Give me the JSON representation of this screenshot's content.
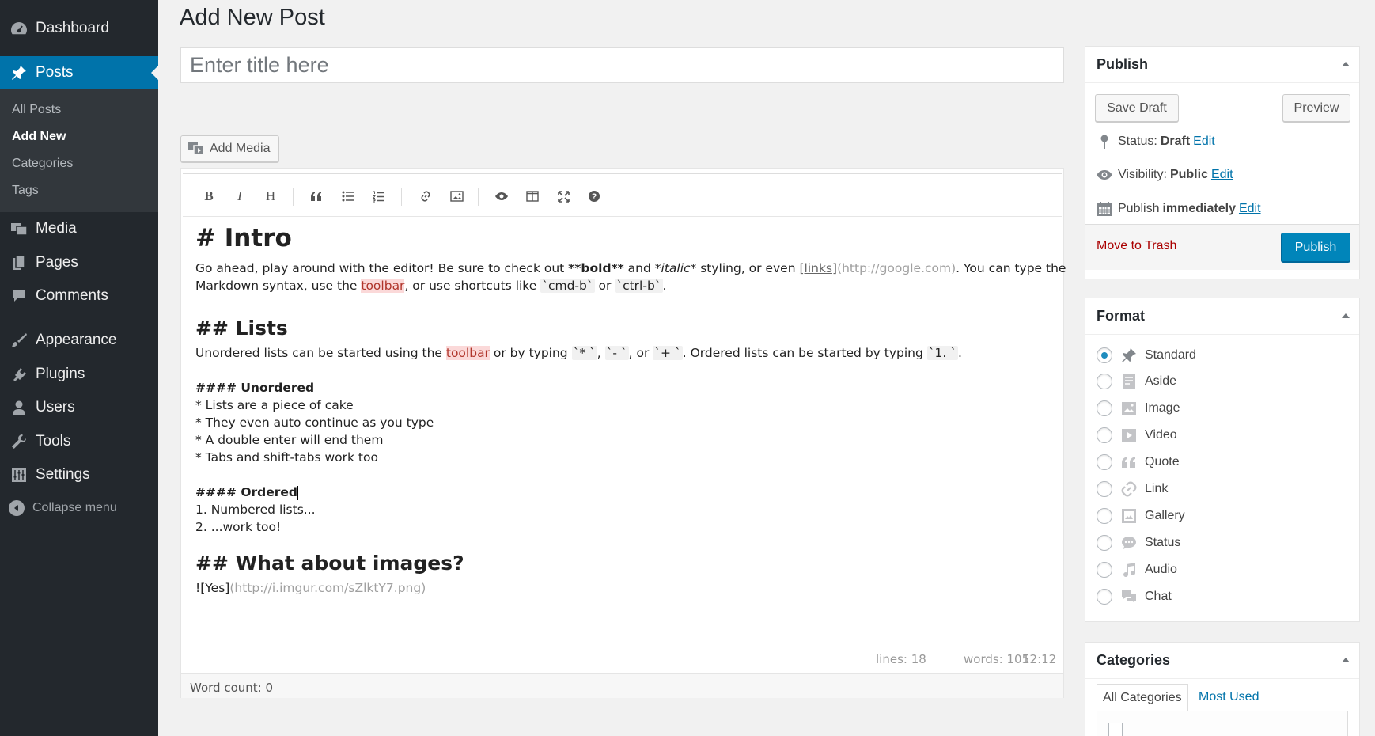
{
  "sidebar": {
    "items": [
      {
        "label": "Dashboard",
        "icon": "dashboard-icon"
      },
      {
        "label": "Posts",
        "icon": "pin-icon"
      },
      {
        "label": "Media",
        "icon": "media-icon"
      },
      {
        "label": "Pages",
        "icon": "pages-icon"
      },
      {
        "label": "Comments",
        "icon": "comment-icon"
      },
      {
        "label": "Appearance",
        "icon": "brush-icon"
      },
      {
        "label": "Plugins",
        "icon": "plug-icon"
      },
      {
        "label": "Users",
        "icon": "user-icon"
      },
      {
        "label": "Tools",
        "icon": "wrench-icon"
      },
      {
        "label": "Settings",
        "icon": "settings-icon"
      }
    ],
    "submenu": [
      "All Posts",
      "Add New",
      "Categories",
      "Tags"
    ],
    "collapse_label": "Collapse menu"
  },
  "main": {
    "page_title": "Add New Post",
    "title_placeholder": "Enter title here",
    "add_media_label": "Add Media"
  },
  "editor": {
    "toolbar": [
      "bold-icon",
      "italic-icon",
      "heading-icon",
      "quote-icon",
      "unordered-list-icon",
      "ordered-list-icon",
      "link-icon",
      "image-icon",
      "preview-icon",
      "side-by-side-icon",
      "fullscreen-icon",
      "help-icon"
    ],
    "content": {
      "intro_heading": "# Intro",
      "p1_a": "Go ahead, play around with the editor! Be sure to check out ",
      "p1_bold": "**bold**",
      "p1_b": " and ",
      "p1_italic": "*italic*",
      "p1_c": " styling, or even ",
      "p1_link": "[links]",
      "p1_url": "(http://google.com)",
      "p1_d": ". You can type the",
      "p2_a": "Markdown syntax, use the ",
      "p2_toolbar": "toolbar",
      "p2_b": ", or use shortcuts like ",
      "p2_code1": "`cmd-b`",
      "p2_c": " or ",
      "p2_code2": "`ctrl-b`",
      "p2_d": ".",
      "lists_heading": "## Lists",
      "l1_a": "Unordered lists can be started using the ",
      "l1_toolbar": "toolbar",
      "l1_b": " or by typing ",
      "l1_code1": "`* `",
      "l1_c": ", ",
      "l1_code2": "`- `",
      "l1_d": ", or ",
      "l1_code3": "`+ `",
      "l1_e": ". Ordered lists can be started by typing ",
      "l1_code4": "`1. `",
      "l1_f": ".",
      "unordered_heading": "#### Unordered",
      "u1": "* Lists are a piece of cake",
      "u2": "* They even auto continue as you type",
      "u3": "* A double enter will end them",
      "u4": "* Tabs and shift-tabs work too",
      "ordered_heading": "#### Ordered",
      "o1": "1. Numbered lists...",
      "o2": "2. ...work too!",
      "images_heading": "## What about images?",
      "img_a": "![Yes]",
      "img_url": "(http://i.imgur.com/sZlktY7.png)"
    },
    "status": {
      "lines": "lines: 18",
      "words": "words: 105",
      "cursor": "12:12"
    },
    "word_count": "Word count: 0"
  },
  "publish": {
    "title": "Publish",
    "save_draft": "Save Draft",
    "preview": "Preview",
    "status_label": "Status:",
    "status_value": "Draft",
    "visibility_label": "Visibility:",
    "visibility_value": "Public",
    "publish_label": "Publish",
    "publish_value": "immediately",
    "edit": "Edit",
    "trash": "Move to Trash",
    "publish_button": "Publish"
  },
  "format": {
    "title": "Format",
    "selected": "Standard",
    "options": [
      {
        "label": "Standard",
        "icon": "pin-icon"
      },
      {
        "label": "Aside",
        "icon": "aside-icon"
      },
      {
        "label": "Image",
        "icon": "image-icon"
      },
      {
        "label": "Video",
        "icon": "video-icon"
      },
      {
        "label": "Quote",
        "icon": "quote-icon"
      },
      {
        "label": "Link",
        "icon": "link-icon"
      },
      {
        "label": "Gallery",
        "icon": "gallery-icon"
      },
      {
        "label": "Status",
        "icon": "status-icon"
      },
      {
        "label": "Audio",
        "icon": "audio-icon"
      },
      {
        "label": "Chat",
        "icon": "chat-icon"
      }
    ]
  },
  "categories": {
    "title": "Categories",
    "tabs": [
      "All Categories",
      "Most Used"
    ]
  },
  "colors": {
    "sidebar": "#23282d",
    "accent": "#0073aa",
    "primary_button": "#0085ba",
    "trash": "#aa0000"
  }
}
